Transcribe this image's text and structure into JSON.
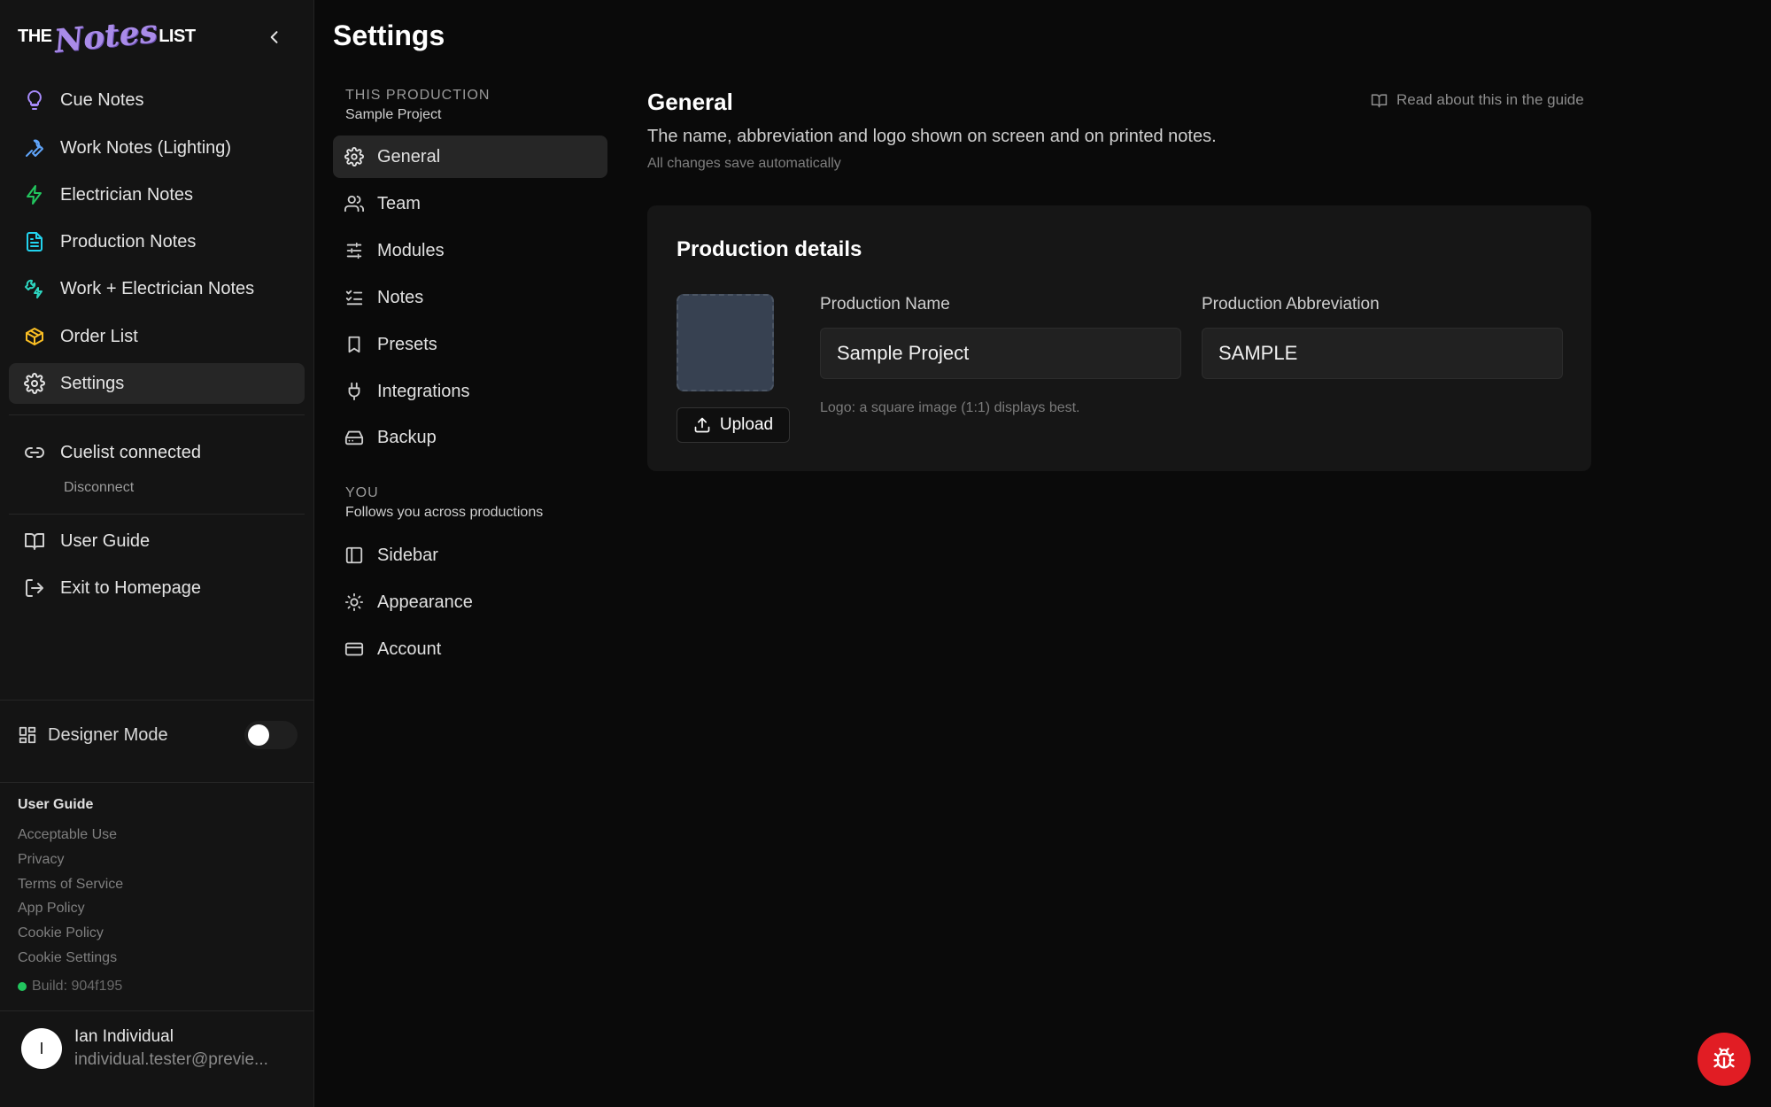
{
  "brand": {
    "the": "THE",
    "notes": "Notes",
    "list": "LIST"
  },
  "sidebar": {
    "nav": [
      {
        "label": "Cue Notes",
        "icon": "lightbulb-icon",
        "color": "#a78bfa"
      },
      {
        "label": "Work Notes (Lighting)",
        "icon": "wrench-icon",
        "color": "#60a5fa"
      },
      {
        "label": "Electrician Notes",
        "icon": "bolt-icon",
        "color": "#22c55e"
      },
      {
        "label": "Production Notes",
        "icon": "document-icon",
        "color": "#22d3ee"
      },
      {
        "label": "Work + Electrician Notes",
        "icon": "wrench-bolt-icon",
        "color": "#2dd4bf"
      },
      {
        "label": "Order List",
        "icon": "package-icon",
        "color": "#fbbf24"
      },
      {
        "label": "Settings",
        "icon": "gear-icon",
        "color": "#e5e5e5"
      }
    ],
    "cuelist": {
      "label": "Cuelist connected",
      "disconnect": "Disconnect"
    },
    "user_guide": "User Guide",
    "exit": "Exit to Homepage",
    "designer_mode": {
      "label": "Designer Mode",
      "enabled": false
    },
    "footer": {
      "title": "User Guide",
      "links": [
        "Acceptable Use",
        "Privacy",
        "Terms of Service",
        "App Policy",
        "Cookie Policy",
        "Cookie Settings"
      ],
      "build": "Build: 904f195"
    },
    "user": {
      "initial": "I",
      "name": "Ian Individual",
      "email": "individual.tester@previe..."
    }
  },
  "settings": {
    "title": "Settings",
    "production_section": {
      "heading": "THIS PRODUCTION",
      "subtitle": "Sample Project"
    },
    "production_items": [
      {
        "label": "General",
        "icon": "gear-icon"
      },
      {
        "label": "Team",
        "icon": "users-icon"
      },
      {
        "label": "Modules",
        "icon": "sliders-icon"
      },
      {
        "label": "Notes",
        "icon": "checklist-icon"
      },
      {
        "label": "Presets",
        "icon": "bookmark-icon"
      },
      {
        "label": "Integrations",
        "icon": "plug-icon"
      },
      {
        "label": "Backup",
        "icon": "drive-icon"
      }
    ],
    "you_section": {
      "heading": "YOU",
      "subtitle": "Follows you across productions"
    },
    "you_items": [
      {
        "label": "Sidebar",
        "icon": "sidebar-icon"
      },
      {
        "label": "Appearance",
        "icon": "sun-icon"
      },
      {
        "label": "Account",
        "icon": "credit-card-icon"
      }
    ]
  },
  "content": {
    "title": "General",
    "guide_link": "Read about this in the guide",
    "description": "The name, abbreviation and logo shown on screen and on printed notes.",
    "autosave_note": "All changes save automatically",
    "card": {
      "title": "Production details",
      "upload_label": "Upload",
      "name_label": "Production Name",
      "name_value": "Sample Project",
      "abbr_label": "Production Abbreviation",
      "abbr_value": "SAMPLE",
      "logo_hint": "Logo: a square image (1:1) displays best."
    }
  },
  "colors": {
    "accent_bug": "#e11d24",
    "status_ok": "#22c55e"
  }
}
